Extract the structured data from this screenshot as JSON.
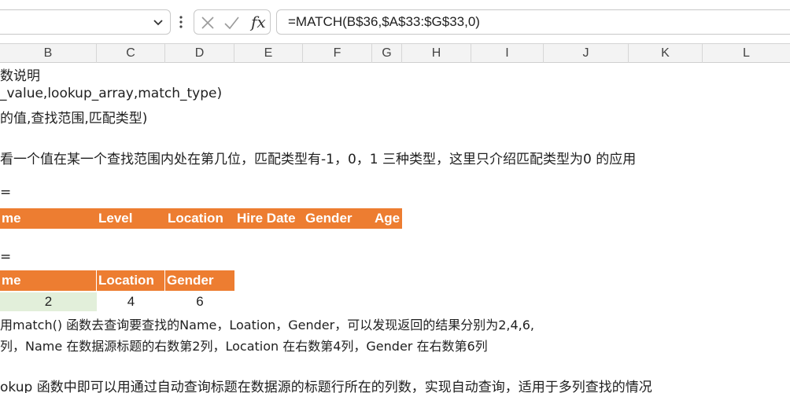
{
  "formula_bar": {
    "formula": "=MATCH(B$36,$A$33:$G$33,0)",
    "fx_label": "fx"
  },
  "columns": [
    "B",
    "C",
    "D",
    "E",
    "F",
    "G",
    "H",
    "I",
    "J",
    "K",
    "L"
  ],
  "rows": {
    "line1": "数说明",
    "line2": "_value,lookup_array,match_type)",
    "line3": "的值,查找范围,匹配类型)",
    "line4": "看一个值在某一个查找范围内处在第几位，匹配类型有-1，0，1 三种类型，这里只介绍匹配类型为0 的应用",
    "mark1": "=",
    "mark2": "=",
    "line5": "用match() 函数去查询要查找的Name，Loation，Gender，可以发现返回的结果分别为2,4,6,",
    "line6": "列，Name 在数据源标题的右数第2列，Location 在右数第4列，Gender 在右数第6列",
    "line7": "okup 函数中即可以用通过自动查询标题在数据源的标题行所在的列数，实现自动查询，适用于多列查找的情况"
  },
  "table1": {
    "headers": [
      "me",
      "Level",
      "Location",
      "Hire Date",
      "Gender",
      "Age"
    ]
  },
  "table2": {
    "headers": [
      "me",
      "Location",
      "Gender"
    ],
    "values": [
      "2",
      "4",
      "6"
    ]
  },
  "colors": {
    "header_orange": "#ed7d31",
    "header_text": "#ffffff",
    "selected_green": "#e2efda"
  }
}
